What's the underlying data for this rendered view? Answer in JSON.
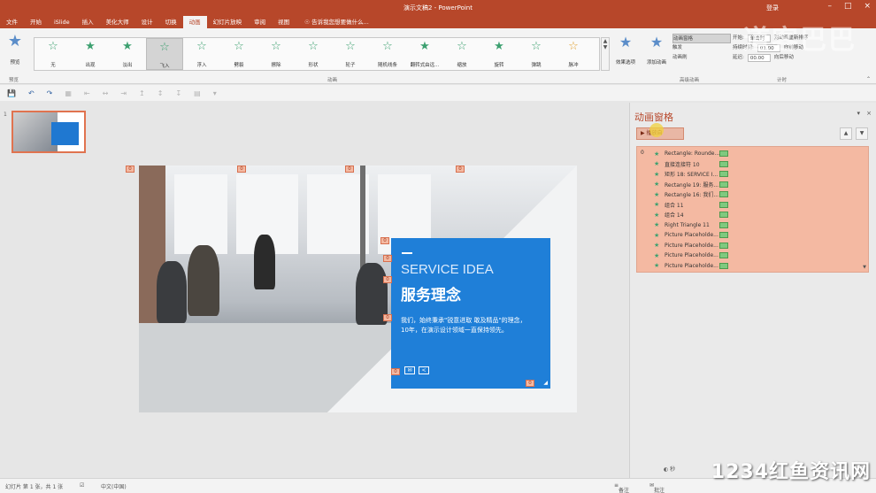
{
  "app": {
    "title": "演示文稿2 - PowerPoint",
    "user": "登录",
    "share": "共享"
  },
  "tabs": [
    "文件",
    "开始",
    "iSlide",
    "插入",
    "美化大师",
    "设计",
    "切换",
    "动画",
    "幻灯片放映",
    "审阅",
    "视图"
  ],
  "tellme": "告诉我您想要做什么...",
  "ribbon": {
    "preview_label": "预览",
    "animations": [
      {
        "label": "无",
        "selected": false
      },
      {
        "label": "出现",
        "selected": false
      },
      {
        "label": "淡出",
        "selected": false
      },
      {
        "label": "飞入",
        "selected": true
      },
      {
        "label": "浮入",
        "selected": false
      },
      {
        "label": "劈裂",
        "selected": false
      },
      {
        "label": "擦除",
        "selected": false
      },
      {
        "label": "形状",
        "selected": false
      },
      {
        "label": "轮子",
        "selected": false
      },
      {
        "label": "随机线条",
        "selected": false
      },
      {
        "label": "翻转式由远...",
        "selected": false
      },
      {
        "label": "缩放",
        "selected": false
      },
      {
        "label": "旋转",
        "selected": false
      },
      {
        "label": "弹跳",
        "selected": false
      },
      {
        "label": "脉冲",
        "selected": false
      }
    ],
    "effect_options": "效果选项",
    "add_animation": "添加动画",
    "advanced": [
      "动画窗格",
      "触发",
      "动画刷"
    ],
    "timing": {
      "start_label": "开始:",
      "start_value": "单击时",
      "duration_label": "持续时间:",
      "duration_value": "01.00",
      "delay_label": "延迟:",
      "delay_value": "00.00",
      "reorder_title": "对动画重新排序",
      "move_earlier": "向前移动",
      "move_later": "向后移动"
    },
    "groups": [
      "预览",
      "动画",
      "高级动画",
      "计时"
    ]
  },
  "thumbnail": {
    "number": "1"
  },
  "slide": {
    "en_title": "SERVICE IDEA",
    "zh_title": "服务理念",
    "body": "我们，始终秉承\"锐意进取 敢及精品\"的理念，10年，在演示设计领域一直保持领先。",
    "tags": [
      "0",
      "0",
      "0",
      "0",
      "0",
      "0",
      "0",
      "0",
      "0",
      "0"
    ]
  },
  "pane": {
    "title": "动画窗格",
    "play_button": "播放自",
    "sequence_number": "0",
    "items": [
      "Rectangle: Rounde...",
      "直接连接符 10",
      "矩形 18: SERVICE I...",
      "Rectangle 19: 服务...",
      "Rectangle 16: 我们...",
      "组合 11",
      "组合 14",
      "Right Triangle 11",
      "Picture Placeholde...",
      "Picture Placeholde...",
      "Picture Placeholde...",
      "Picture Placeholde..."
    ],
    "seconds_label": "秒"
  },
  "status": {
    "slide_info": "幻灯片 第 1 张，共 1 张",
    "language": "中文(中国)",
    "notes": "备注",
    "comments": "批注"
  },
  "watermarks": {
    "logo": "道客巴巴",
    "site": "1234红鱼资讯网"
  },
  "colors": {
    "accent": "#b7472a",
    "slide_blue": "#1f7fd8",
    "pane_highlight": "#f4b9a2",
    "anim_star": "#3da070"
  }
}
